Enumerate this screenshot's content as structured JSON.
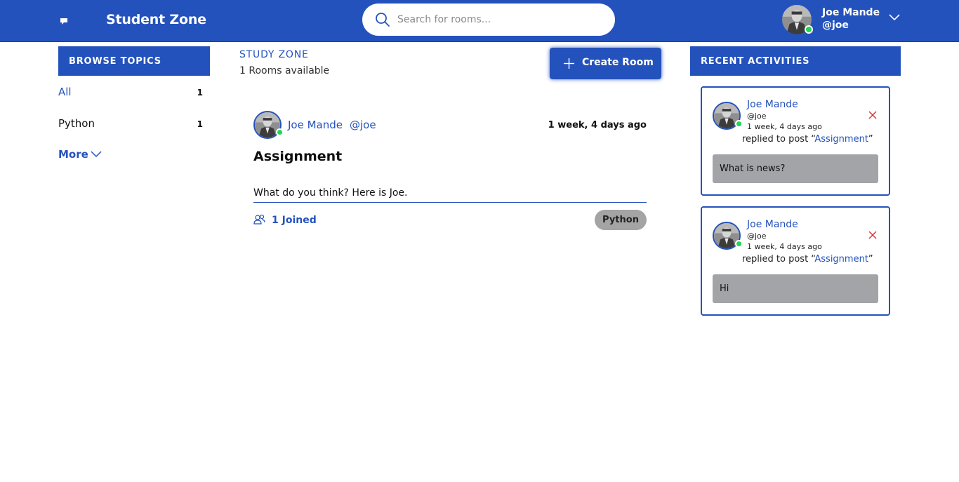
{
  "header": {
    "brand": "Student Zone",
    "search_placeholder": "Search for rooms...",
    "user": {
      "name": "Joe Mande",
      "handle": "@joe"
    },
    "icons": {
      "logo": "chat-bubble-icon",
      "search": "search-icon",
      "menu": "chevron-down-icon"
    }
  },
  "colors": {
    "primary": "#2452bd",
    "online": "#1fd655",
    "tag_bg": "#a4a4a4",
    "close": "#d32f2f"
  },
  "topics": {
    "heading": "BROWSE TOPICS",
    "items": [
      {
        "label": "All",
        "count": "1"
      },
      {
        "label": "Python",
        "count": "1"
      }
    ],
    "more_label": "More"
  },
  "main": {
    "title": "STUDY ZONE",
    "rooms_count": "1 Rooms available",
    "create_label": "Create Room",
    "rooms": [
      {
        "host_name": "Joe Mande",
        "host_handle": "@joe",
        "time": "1 week, 4 days ago",
        "name": "Assignment",
        "description": "What do you think? Here is Joe.",
        "joined": "1 Joined",
        "topic": "Python"
      }
    ]
  },
  "activity": {
    "heading": "RECENT ACTIVITIES",
    "items": [
      {
        "name": "Joe Mande",
        "handle": "@joe",
        "time": "1 week, 4 days ago",
        "action_prefix": "replied to post “",
        "post": "Assignment",
        "action_suffix": "”",
        "message": "What is news?"
      },
      {
        "name": "Joe Mande",
        "handle": "@joe",
        "time": "1 week, 4 days ago",
        "action_prefix": "replied to post “",
        "post": "Assignment",
        "action_suffix": "”",
        "message": "Hi"
      }
    ]
  }
}
